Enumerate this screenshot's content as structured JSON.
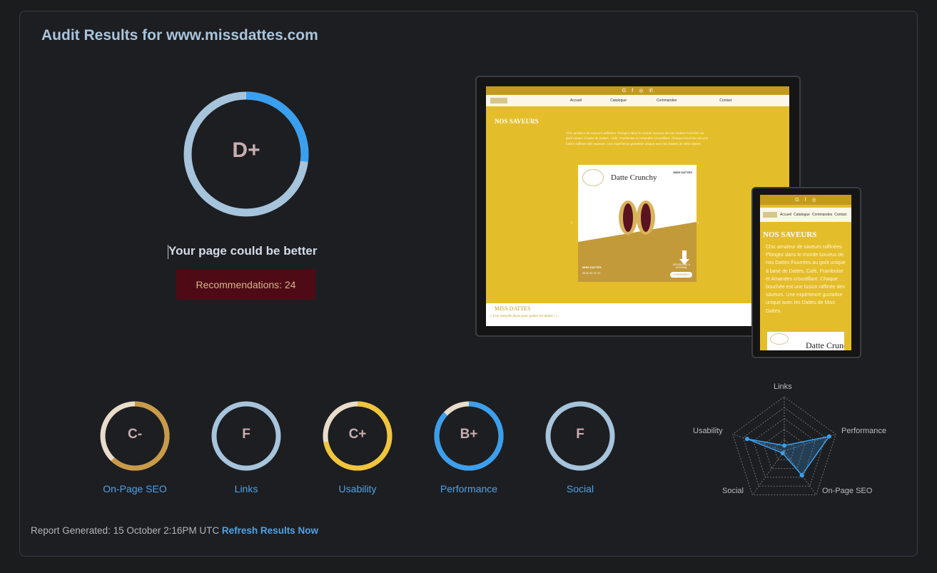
{
  "title": "Audit Results for www.missdattes.com",
  "overall": {
    "grade": "D+",
    "score_fraction": 0.27,
    "message": "Your page could be better"
  },
  "recommendations_label": "Recommendations: 24",
  "site_preview": {
    "heading": "NOS SAVEURS",
    "nav_items": [
      "Accueil",
      "Catalogue",
      "Commandes",
      "Contact"
    ],
    "paragraph": "Chic amateur de saveurs raffinées. Plongez dans le monde luxueux de nos Dattes Fourrées au goût unique à base de Dattes, Café, Framboise et Amandes croustillant. Chaque bouchée est une fusion raffinée des saveurs. Une expérience gustative unique avec les Dattes de Miss Dattes.",
    "product_name": "Datte Crunchy",
    "brand_small": "MISS DATTES",
    "brand_footer": "MISS DATTES",
    "tagline": "« Une nouvelle façon pour goûter les dattes ! »",
    "card_footer": "MISS DATTES",
    "card_phone": "0676 92 37 21",
    "card_cta": "COMMANDER",
    "card_arrow_text": "DÉLICIEUSE & ORIGINAL"
  },
  "categories": [
    {
      "grade": "C-",
      "label": "On-Page SEO",
      "fraction": 0.62,
      "color": "#c99b48"
    },
    {
      "grade": "F",
      "label": "Links",
      "fraction": 0.0,
      "color": "#a6c4dc"
    },
    {
      "grade": "C+",
      "label": "Usability",
      "fraction": 0.72,
      "color": "#f1c53b"
    },
    {
      "grade": "B+",
      "label": "Performance",
      "fraction": 0.87,
      "color": "#3a9fef"
    },
    {
      "grade": "F",
      "label": "Social",
      "fraction": 0.0,
      "color": "#a6c4dc"
    }
  ],
  "radar": {
    "axes": [
      "Links",
      "Performance",
      "On-Page SEO",
      "Social",
      "Usability"
    ],
    "values": [
      0.1,
      0.87,
      0.55,
      0.05,
      0.72
    ]
  },
  "footer": {
    "report_generated": "Report Generated: 15 October 2:16PM UTC",
    "refresh_label": "Refresh Results Now"
  },
  "colors": {
    "accent": "#3a9fef",
    "track": "#a6c4dc",
    "recommendations_bg": "#4e0b16"
  }
}
